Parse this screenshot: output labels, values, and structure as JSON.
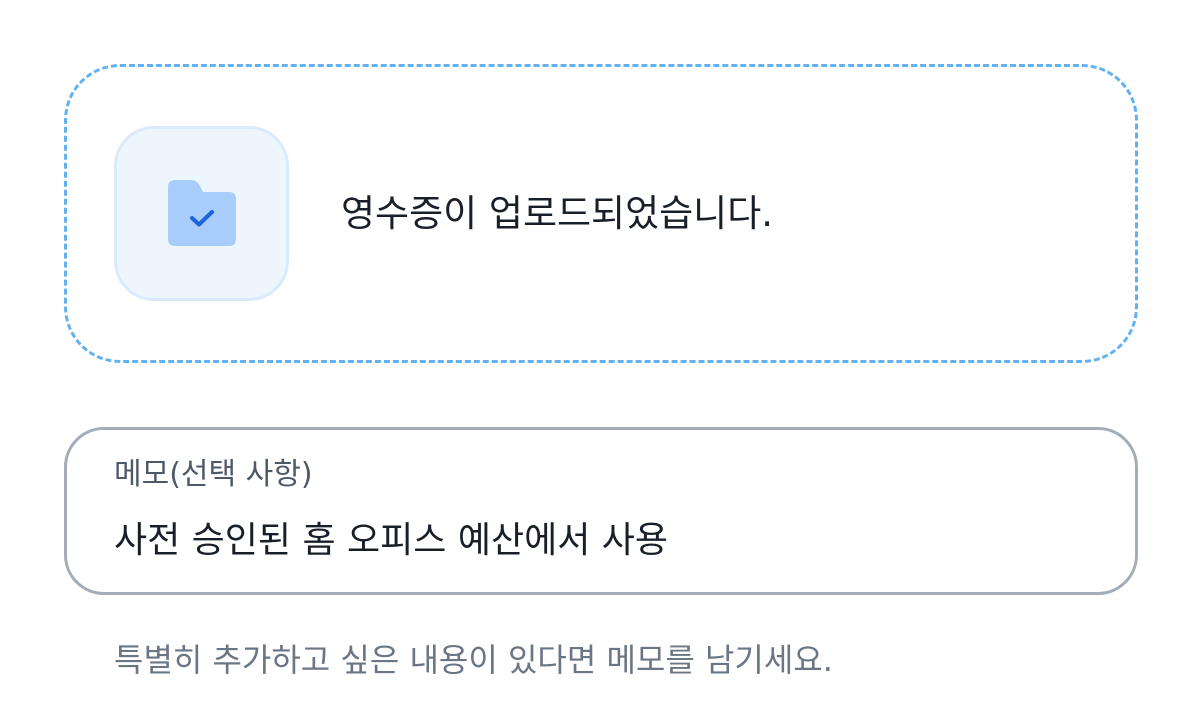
{
  "upload": {
    "icon": "folder-check-icon",
    "status_text": "영수증이 업로드되었습니다."
  },
  "memo": {
    "label": "메모(선택 사항)",
    "value": "사전 승인된 홈 오피스 예산에서 사용",
    "helper": "특별히 추가하고 싶은 내용이 있다면 메모를 남기세요."
  },
  "colors": {
    "dashed_border": "#62b2f3",
    "tile_background": "#eef6fd",
    "folder": "#a8cdfb",
    "check": "#1b64da",
    "field_border": "#a4acb7"
  }
}
